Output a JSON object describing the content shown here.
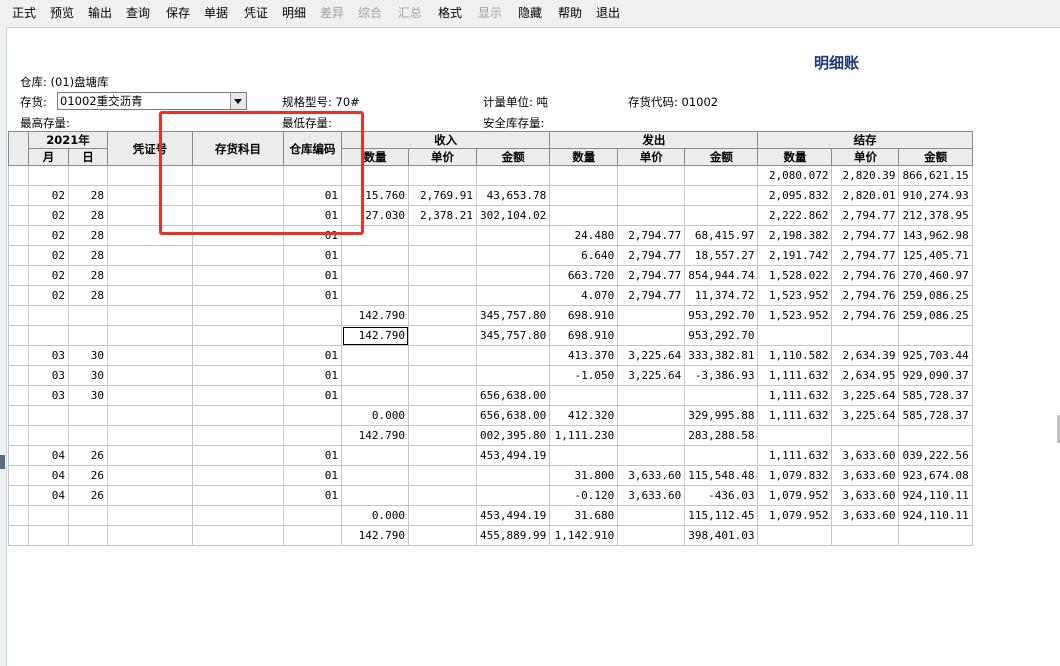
{
  "menu": [
    "正式",
    "预览",
    "输出",
    "查询",
    "保存",
    "单据",
    "凭证",
    "明细",
    "差异",
    "综合",
    "汇总",
    "格式",
    "显示",
    "隐藏",
    "帮助",
    "退出"
  ],
  "menu_disabled": [
    8,
    9,
    10,
    12
  ],
  "title": "明细账",
  "info": {
    "warehouse_label": "仓库:",
    "warehouse_value": "(01)盘塘库",
    "inventory_label": "存货:",
    "inventory_value": "01002重交沥青",
    "spec": "规格型号: 70#",
    "unit": "计量单位: 吨",
    "inventory_code": "存货代码: 01002",
    "max_stock": "最高存量:",
    "min_stock": "最低存量:",
    "safety_stock": "安全库存量:"
  },
  "headers": {
    "year": "2021年",
    "month": "月",
    "day": "日",
    "voucher": "凭证号",
    "subject": "存货科目",
    "warehouse_code": "仓库编码",
    "income": "收入",
    "issue": "发出",
    "balance": "结存",
    "qty": "数量",
    "price": "单价",
    "amount": "金额"
  },
  "rows": [
    [
      "",
      "",
      "",
      "",
      "",
      "",
      "",
      "",
      "",
      "",
      "",
      "2,080.072",
      "2,820.39",
      "866,621.15"
    ],
    [
      "02",
      "28",
      "",
      "",
      "01",
      "15.760",
      "2,769.91",
      "43,653.78",
      "",
      "",
      "",
      "2,095.832",
      "2,820.01",
      "910,274.93"
    ],
    [
      "02",
      "28",
      "",
      "",
      "01",
      "27.030",
      "2,378.21",
      "302,104.02",
      "",
      "",
      "",
      "2,222.862",
      "2,794.77",
      "212,378.95"
    ],
    [
      "02",
      "28",
      "",
      "",
      "01",
      "",
      "",
      "",
      "24.480",
      "2,794.77",
      "68,415.97",
      "2,198.382",
      "2,794.77",
      "143,962.98"
    ],
    [
      "02",
      "28",
      "",
      "",
      "01",
      "",
      "",
      "",
      "6.640",
      "2,794.77",
      "18,557.27",
      "2,191.742",
      "2,794.77",
      "125,405.71"
    ],
    [
      "02",
      "28",
      "",
      "",
      "01",
      "",
      "",
      "",
      "663.720",
      "2,794.77",
      "854,944.74",
      "1,528.022",
      "2,794.76",
      "270,460.97"
    ],
    [
      "02",
      "28",
      "",
      "",
      "01",
      "",
      "",
      "",
      "4.070",
      "2,794.77",
      "11,374.72",
      "1,523.952",
      "2,794.76",
      "259,086.25"
    ],
    [
      "",
      "",
      "",
      "",
      "",
      "142.790",
      "",
      "345,757.80",
      "698.910",
      "",
      "953,292.70",
      "1,523.952",
      "2,794.76",
      "259,086.25"
    ],
    [
      "",
      "",
      "",
      "",
      "",
      "142.790",
      "",
      "345,757.80",
      "698.910",
      "",
      "953,292.70",
      "",
      "",
      ""
    ],
    [
      "03",
      "30",
      "",
      "",
      "01",
      "",
      "",
      "",
      "413.370",
      "3,225.64",
      "333,382.81",
      "1,110.582",
      "2,634.39",
      "925,703.44"
    ],
    [
      "03",
      "30",
      "",
      "",
      "01",
      "",
      "",
      "",
      "-1.050",
      "3,225.64",
      "-3,386.93",
      "1,111.632",
      "2,634.95",
      "929,090.37"
    ],
    [
      "03",
      "30",
      "",
      "",
      "01",
      "",
      "",
      "656,638.00",
      "",
      "",
      "",
      "1,111.632",
      "3,225.64",
      "585,728.37"
    ],
    [
      "",
      "",
      "",
      "",
      "",
      "0.000",
      "",
      "656,638.00",
      "412.320",
      "",
      "329,995.88",
      "1,111.632",
      "3,225.64",
      "585,728.37"
    ],
    [
      "",
      "",
      "",
      "",
      "",
      "142.790",
      "",
      "002,395.80",
      "1,111.230",
      "",
      "283,288.58",
      "",
      "",
      ""
    ],
    [
      "04",
      "26",
      "",
      "",
      "01",
      "",
      "",
      "453,494.19",
      "",
      "",
      "",
      "1,111.632",
      "3,633.60",
      "039,222.56"
    ],
    [
      "04",
      "26",
      "",
      "",
      "01",
      "",
      "",
      "",
      "31.800",
      "3,633.60",
      "115,548.48",
      "1,079.832",
      "3,633.60",
      "923,674.08"
    ],
    [
      "04",
      "26",
      "",
      "",
      "01",
      "",
      "",
      "",
      "-0.120",
      "3,633.60",
      "-436.03",
      "1,079.952",
      "3,633.60",
      "924,110.11"
    ],
    [
      "",
      "",
      "",
      "",
      "",
      "0.000",
      "",
      "453,494.19",
      "31.680",
      "",
      "115,112.45",
      "1,079.952",
      "3,633.60",
      "924,110.11"
    ],
    [
      "",
      "",
      "",
      "",
      "",
      "142.790",
      "",
      "455,889.99",
      "1,142.910",
      "",
      "398,401.03",
      "",
      "",
      ""
    ]
  ],
  "selected_cell": [
    8,
    5
  ]
}
